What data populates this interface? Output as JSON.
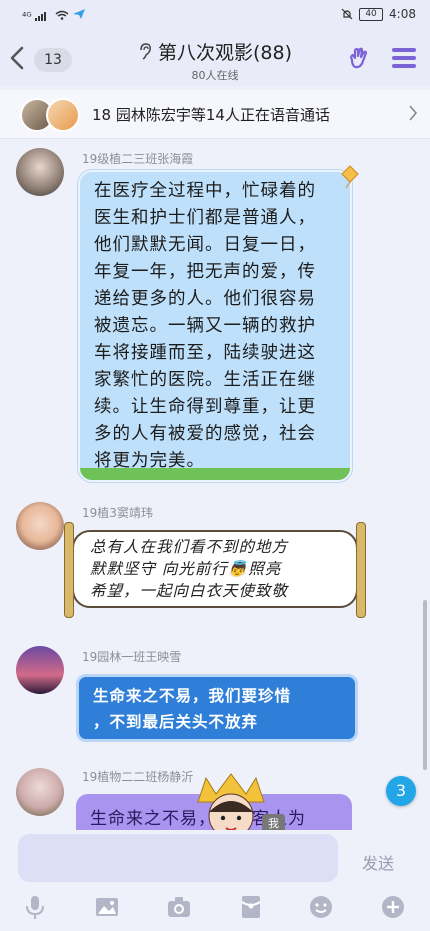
{
  "status_bar": {
    "signal_text": "⁴ᴳ",
    "battery": "40",
    "time": "4:08"
  },
  "header": {
    "unread_count": "13",
    "title": "第八次观影(88)",
    "online": "80人在线"
  },
  "voice_call": {
    "text": "18 园林陈宏宇等14人正在语音通话"
  },
  "messages": [
    {
      "sender": "19级植二三班张海霞",
      "lines": [
        "在医疗全过程中，忙碌着的",
        "医生和护士们都是普通人，",
        "他们默默无闻。日复一日，",
        "年复一年，把无声的爱，传",
        "递给更多的人。他们很容易",
        "被遗忘。一辆又一辆的救护",
        "车将接踵而至，陆续驶进这",
        "家繁忙的医院。生活正在继",
        "续。让生命得到尊重，让更",
        "多的人有被爱的感觉，社会",
        "将更为完美。"
      ]
    },
    {
      "sender": "19植3窦靖玮",
      "lines": [
        "总有人在我们看不到的地方",
        "默默坚守 向光前行👼照亮",
        "希望，一起向白衣天使致敬"
      ]
    },
    {
      "sender": "19园林一班王映雪",
      "lines": [
        "生命来之不易，我们要珍惜",
        "，不到最后关头不放弃"
      ]
    },
    {
      "sender": "19植物二二班杨静沂",
      "lines": [
        "生命来之不易，保得客人为"
      ]
    }
  ],
  "new_messages_badge": "3",
  "input": {
    "placeholder": "",
    "send_label": "发送",
    "sticker_tag": "我"
  },
  "toolbar_icons": [
    "mic-icon",
    "image-icon",
    "camera-icon",
    "red-packet-icon",
    "emoji-icon",
    "plus-icon"
  ],
  "colors": {
    "accent": "#7c63d8",
    "blue_bubble": "#bfe0fa",
    "badge": "#22a6e8"
  }
}
